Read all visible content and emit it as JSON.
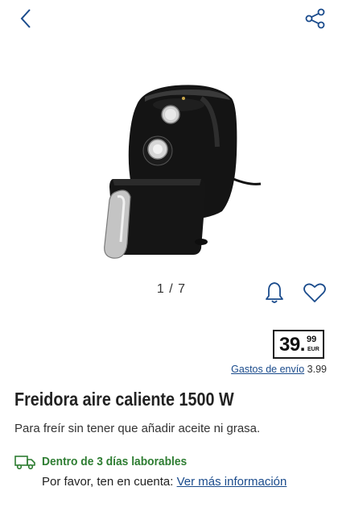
{
  "header": {
    "back_icon": "chevron-left-icon",
    "share_icon": "share-icon"
  },
  "gallery": {
    "image_description": "black air fryer with silver handle and open basket",
    "counter": "1 / 7",
    "bell_icon": "bell-icon",
    "heart_icon": "heart-icon"
  },
  "price": {
    "main": "39.",
    "cents": "99",
    "currency": "EUR"
  },
  "shipping": {
    "link_label": "Gastos de envío",
    "amount": "3.99"
  },
  "product": {
    "title": "Freidora aire caliente 1500 W",
    "subtitle": "Para freír sin tener que añadir aceite ni grasa."
  },
  "delivery": {
    "icon": "truck-icon",
    "text": "Dentro de 3 días laborables",
    "note_prefix": "Por favor, ten en cuenta: ",
    "note_link": "Ver más información"
  },
  "colors": {
    "link_blue": "#1a4b8c",
    "delivery_green": "#2e7d32",
    "icon_blue": "#1a4b8c"
  }
}
